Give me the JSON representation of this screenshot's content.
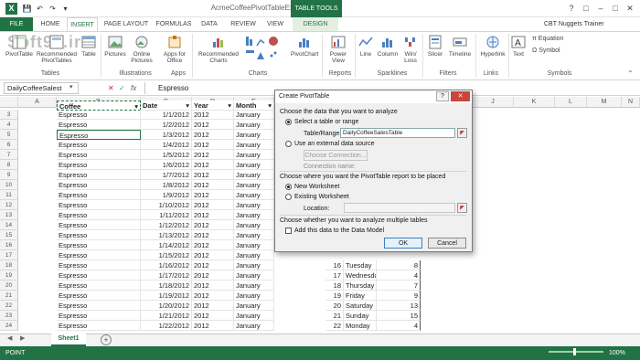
{
  "title_bar": {
    "title": "AcmeCoffeePivotTableExample - Excel",
    "context_tab": "TABLE TOOLS",
    "window_buttons": [
      "?",
      "□",
      "–",
      "□",
      "✕"
    ]
  },
  "tabs": [
    "FILE",
    "HOME",
    "INSERT",
    "PAGE LAYOUT",
    "FORMULAS",
    "DATA",
    "REVIEW",
    "VIEW",
    "DESIGN"
  ],
  "user": "CBT Nuggets Trainer",
  "watermark": "Soft98.ir",
  "ribbon": {
    "buttons": [
      "PivotTable",
      "Recommended PivotTables",
      "Table",
      "Pictures",
      "Online Pictures",
      "Apps for Office",
      "Recommended Charts",
      "PivotChart",
      "Power View",
      "Line",
      "Column",
      "Win/ Loss",
      "Slicer",
      "Timeline",
      "Hyperlink",
      "Text",
      "Equation",
      "Symbol"
    ],
    "groups": [
      "Tables",
      "Illustrations",
      "Apps",
      "Charts",
      "Reports",
      "Sparklines",
      "Filters",
      "Links",
      "Symbols"
    ]
  },
  "formula_bar": {
    "name_box": "DailyCoffeeSalest",
    "fx": "fx",
    "value": "Espresso"
  },
  "columns": {
    "left": [
      "A",
      "B",
      "C",
      "D",
      "E"
    ],
    "right": [
      "J",
      "K",
      "L",
      "M",
      "N"
    ]
  },
  "table_headers": [
    "Coffee",
    "Date",
    "Year",
    "Month"
  ],
  "rows": [
    {
      "n": "3",
      "coffee": "Espresso",
      "date": "1/1/2012",
      "year": "2012",
      "month": "January"
    },
    {
      "n": "4",
      "coffee": "Espresso",
      "date": "1/2/2012",
      "year": "2012",
      "month": "January"
    },
    {
      "n": "5",
      "coffee": "Espresso",
      "date": "1/3/2012",
      "year": "2012",
      "month": "January"
    },
    {
      "n": "6",
      "coffee": "Espresso",
      "date": "1/4/2012",
      "year": "2012",
      "month": "January"
    },
    {
      "n": "7",
      "coffee": "Espresso",
      "date": "1/5/2012",
      "year": "2012",
      "month": "January"
    },
    {
      "n": "8",
      "coffee": "Espresso",
      "date": "1/6/2012",
      "year": "2012",
      "month": "January"
    },
    {
      "n": "9",
      "coffee": "Espresso",
      "date": "1/7/2012",
      "year": "2012",
      "month": "January"
    },
    {
      "n": "10",
      "coffee": "Espresso",
      "date": "1/8/2012",
      "year": "2012",
      "month": "January"
    },
    {
      "n": "11",
      "coffee": "Espresso",
      "date": "1/9/2012",
      "year": "2012",
      "month": "January"
    },
    {
      "n": "12",
      "coffee": "Espresso",
      "date": "1/10/2012",
      "year": "2012",
      "month": "January"
    },
    {
      "n": "13",
      "coffee": "Espresso",
      "date": "1/11/2012",
      "year": "2012",
      "month": "January"
    },
    {
      "n": "14",
      "coffee": "Espresso",
      "date": "1/12/2012",
      "year": "2012",
      "month": "January"
    },
    {
      "n": "15",
      "coffee": "Espresso",
      "date": "1/13/2012",
      "year": "2012",
      "month": "January"
    },
    {
      "n": "16",
      "coffee": "Espresso",
      "date": "1/14/2012",
      "year": "2012",
      "month": "January"
    },
    {
      "n": "17",
      "coffee": "Espresso",
      "date": "1/15/2012",
      "year": "2012",
      "month": "January"
    },
    {
      "n": "18",
      "coffee": "Espresso",
      "date": "1/16/2012",
      "year": "2012",
      "month": "January",
      "day": "16",
      "weekday": "Tuesday",
      "val": "8"
    },
    {
      "n": "19",
      "coffee": "Espresso",
      "date": "1/17/2012",
      "year": "2012",
      "month": "January",
      "day": "17",
      "weekday": "Wednesday",
      "val": "4"
    },
    {
      "n": "20",
      "coffee": "Espresso",
      "date": "1/18/2012",
      "year": "2012",
      "month": "January",
      "day": "18",
      "weekday": "Thursday",
      "val": "7"
    },
    {
      "n": "21",
      "coffee": "Espresso",
      "date": "1/19/2012",
      "year": "2012",
      "month": "January",
      "day": "19",
      "weekday": "Friday",
      "val": "9"
    },
    {
      "n": "22",
      "coffee": "Espresso",
      "date": "1/20/2012",
      "year": "2012",
      "month": "January",
      "day": "20",
      "weekday": "Saturday",
      "val": "13"
    },
    {
      "n": "23",
      "coffee": "Espresso",
      "date": "1/21/2012",
      "year": "2012",
      "month": "January",
      "day": "21",
      "weekday": "Sunday",
      "val": "15"
    },
    {
      "n": "24",
      "coffee": "Espresso",
      "date": "1/22/2012",
      "year": "2012",
      "month": "January",
      "day": "22",
      "weekday": "Monday",
      "val": "4"
    },
    {
      "n": "25",
      "coffee": "Espresso",
      "date": "1/23/2012",
      "year": "2012",
      "month": "January",
      "day": "23",
      "weekday": "Tuesday",
      "val": "3"
    }
  ],
  "sheet_tab": "Sheet1",
  "status": "POINT",
  "zoom": "100%",
  "dialog": {
    "title": "Create PivotTable",
    "section1": "Choose the data that you want to analyze",
    "opt_select_table": "Select a table or range",
    "table_range_label": "Table/Range:",
    "table_range_value": "DailyCoffeeSalesTable",
    "opt_external": "Use an external data source",
    "choose_connection": "Choose Connection...",
    "connection_name": "Connection name:",
    "section2": "Choose where you want the PivotTable report to be placed",
    "opt_new_ws": "New Worksheet",
    "opt_existing_ws": "Existing Worksheet",
    "location_label": "Location:",
    "section3": "Choose whether you want to analyze multiple tables",
    "add_data_model": "Add this data to the Data Model",
    "ok": "OK",
    "cancel": "Cancel"
  },
  "colors": {
    "accent": "#217346"
  }
}
